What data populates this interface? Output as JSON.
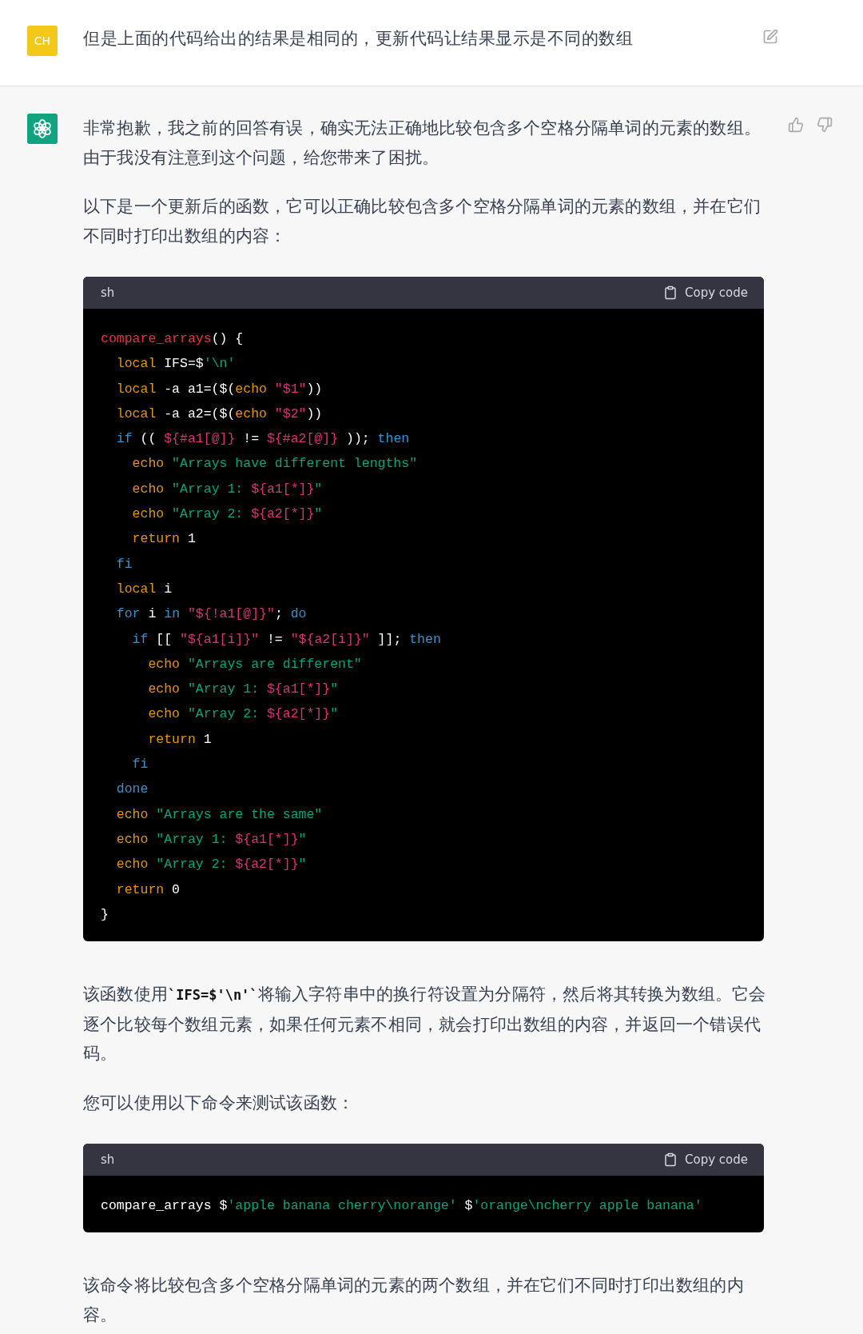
{
  "user_message": {
    "avatar": "CH",
    "text": "但是上面的代码给出的结果是相同的，更新代码让结果显示是不同的数组"
  },
  "assistant_message": {
    "blocks": [
      {
        "kind": "paragraph",
        "parts": [
          {
            "t": "非常抱歉，我之前的回答有误，确实无法正确地比较包含多个空格分隔单词的元素的数组。由于我没有注意到这个问题，给您带来了困扰。"
          }
        ]
      },
      {
        "kind": "paragraph",
        "parts": [
          {
            "t": "以下是一个更新后的函数，它可以正确比较包含多个空格分隔单词的元素的数组，并在它们不同时打印出数组的内容："
          }
        ]
      },
      {
        "kind": "code",
        "language": "sh",
        "copy_label": "Copy code",
        "lines": [
          [
            {
              "kind": "fn",
              "t": "compare_arrays"
            },
            {
              "kind": "plain",
              "t": "() {"
            }
          ],
          [
            {
              "kind": "builtin",
              "t": "  local"
            },
            {
              "kind": "plain",
              "t": " IFS=$"
            },
            {
              "kind": "string",
              "t": "'\\n'"
            }
          ],
          [
            {
              "kind": "builtin",
              "t": "  local"
            },
            {
              "kind": "plain",
              "t": " -a a1=($("
            },
            {
              "kind": "builtin",
              "t": "echo"
            },
            {
              "kind": "var",
              "t": " \"$1\""
            },
            {
              "kind": "plain",
              "t": "))"
            }
          ],
          [
            {
              "kind": "builtin",
              "t": "  local"
            },
            {
              "kind": "plain",
              "t": " -a a2=($("
            },
            {
              "kind": "builtin",
              "t": "echo"
            },
            {
              "kind": "var",
              "t": " \"$2\""
            },
            {
              "kind": "plain",
              "t": "))"
            }
          ],
          [
            {
              "kind": "keyword",
              "t": "  if"
            },
            {
              "kind": "plain",
              "t": " (( "
            },
            {
              "kind": "var",
              "t": "${#a1[@]}"
            },
            {
              "kind": "plain",
              "t": " != "
            },
            {
              "kind": "var",
              "t": "${#a2[@]}"
            },
            {
              "kind": "plain",
              "t": " )); "
            },
            {
              "kind": "keyword",
              "t": "then"
            }
          ],
          [
            {
              "kind": "builtin",
              "t": "    echo"
            },
            {
              "kind": "string",
              "t": " \"Arrays have different lengths\""
            }
          ],
          [
            {
              "kind": "builtin",
              "t": "    echo"
            },
            {
              "kind": "string",
              "t": " \"Array 1: "
            },
            {
              "kind": "var",
              "t": "${a1[*]}"
            },
            {
              "kind": "string",
              "t": "\""
            }
          ],
          [
            {
              "kind": "builtin",
              "t": "    echo"
            },
            {
              "kind": "string",
              "t": " \"Array 2: "
            },
            {
              "kind": "var",
              "t": "${a2[*]}"
            },
            {
              "kind": "string",
              "t": "\""
            }
          ],
          [
            {
              "kind": "builtin",
              "t": "    return"
            },
            {
              "kind": "plain",
              "t": " 1"
            }
          ],
          [
            {
              "kind": "keyword",
              "t": "  fi"
            }
          ],
          [
            {
              "kind": "builtin",
              "t": "  local"
            },
            {
              "kind": "plain",
              "t": " i"
            }
          ],
          [
            {
              "kind": "keyword",
              "t": "  for"
            },
            {
              "kind": "plain",
              "t": " i "
            },
            {
              "kind": "keyword",
              "t": "in"
            },
            {
              "kind": "var",
              "t": " \"${!a1[@]}\""
            },
            {
              "kind": "plain",
              "t": "; "
            },
            {
              "kind": "keyword",
              "t": "do"
            }
          ],
          [
            {
              "kind": "keyword",
              "t": "    if"
            },
            {
              "kind": "plain",
              "t": " [[ "
            },
            {
              "kind": "var",
              "t": "\"${a1[i]}\""
            },
            {
              "kind": "plain",
              "t": " != "
            },
            {
              "kind": "var",
              "t": "\"${a2[i]}\""
            },
            {
              "kind": "plain",
              "t": " ]]; "
            },
            {
              "kind": "keyword",
              "t": "then"
            }
          ],
          [
            {
              "kind": "builtin",
              "t": "      echo"
            },
            {
              "kind": "string",
              "t": " \"Arrays are different\""
            }
          ],
          [
            {
              "kind": "builtin",
              "t": "      echo"
            },
            {
              "kind": "string",
              "t": " \"Array 1: "
            },
            {
              "kind": "var",
              "t": "${a1[*]}"
            },
            {
              "kind": "string",
              "t": "\""
            }
          ],
          [
            {
              "kind": "builtin",
              "t": "      echo"
            },
            {
              "kind": "string",
              "t": " \"Array 2: "
            },
            {
              "kind": "var",
              "t": "${a2[*]}"
            },
            {
              "kind": "string",
              "t": "\""
            }
          ],
          [
            {
              "kind": "builtin",
              "t": "      return"
            },
            {
              "kind": "plain",
              "t": " 1"
            }
          ],
          [
            {
              "kind": "keyword",
              "t": "    fi"
            }
          ],
          [
            {
              "kind": "keyword",
              "t": "  done"
            }
          ],
          [
            {
              "kind": "builtin",
              "t": "  echo"
            },
            {
              "kind": "string",
              "t": " \"Arrays are the same\""
            }
          ],
          [
            {
              "kind": "builtin",
              "t": "  echo"
            },
            {
              "kind": "string",
              "t": " \"Array 1: "
            },
            {
              "kind": "var",
              "t": "${a1[*]}"
            },
            {
              "kind": "string",
              "t": "\""
            }
          ],
          [
            {
              "kind": "builtin",
              "t": "  echo"
            },
            {
              "kind": "string",
              "t": " \"Array 2: "
            },
            {
              "kind": "var",
              "t": "${a2[*]}"
            },
            {
              "kind": "string",
              "t": "\""
            }
          ],
          [
            {
              "kind": "builtin",
              "t": "  return"
            },
            {
              "kind": "plain",
              "t": " 0"
            }
          ],
          [
            {
              "kind": "plain",
              "t": "}"
            }
          ]
        ]
      },
      {
        "kind": "paragraph",
        "parts": [
          {
            "t": "该函数使用"
          },
          {
            "t": "`IFS=$'\\n'`",
            "code": true
          },
          {
            "t": "将输入字符串中的换行符设置为分隔符，然后将其转换为数组。它会逐个比较每个数组元素，如果任何元素不相同，就会打印出数组的内容，并返回一个错误代码。"
          }
        ]
      },
      {
        "kind": "paragraph",
        "parts": [
          {
            "t": "您可以使用以下命令来测试该函数："
          }
        ]
      },
      {
        "kind": "code",
        "language": "sh",
        "copy_label": "Copy code",
        "lines": [
          [
            {
              "kind": "plain",
              "t": "compare_arrays $"
            },
            {
              "kind": "string",
              "t": "'apple banana cherry\\norange'"
            },
            {
              "kind": "plain",
              "t": " $"
            },
            {
              "kind": "string",
              "t": "'orange\\ncherry apple banana'"
            }
          ]
        ]
      },
      {
        "kind": "paragraph",
        "parts": [
          {
            "t": "该命令将比较包含多个空格分隔单词的元素的两个数组，并在它们不同时打印出数组的内容。"
          }
        ]
      }
    ]
  }
}
